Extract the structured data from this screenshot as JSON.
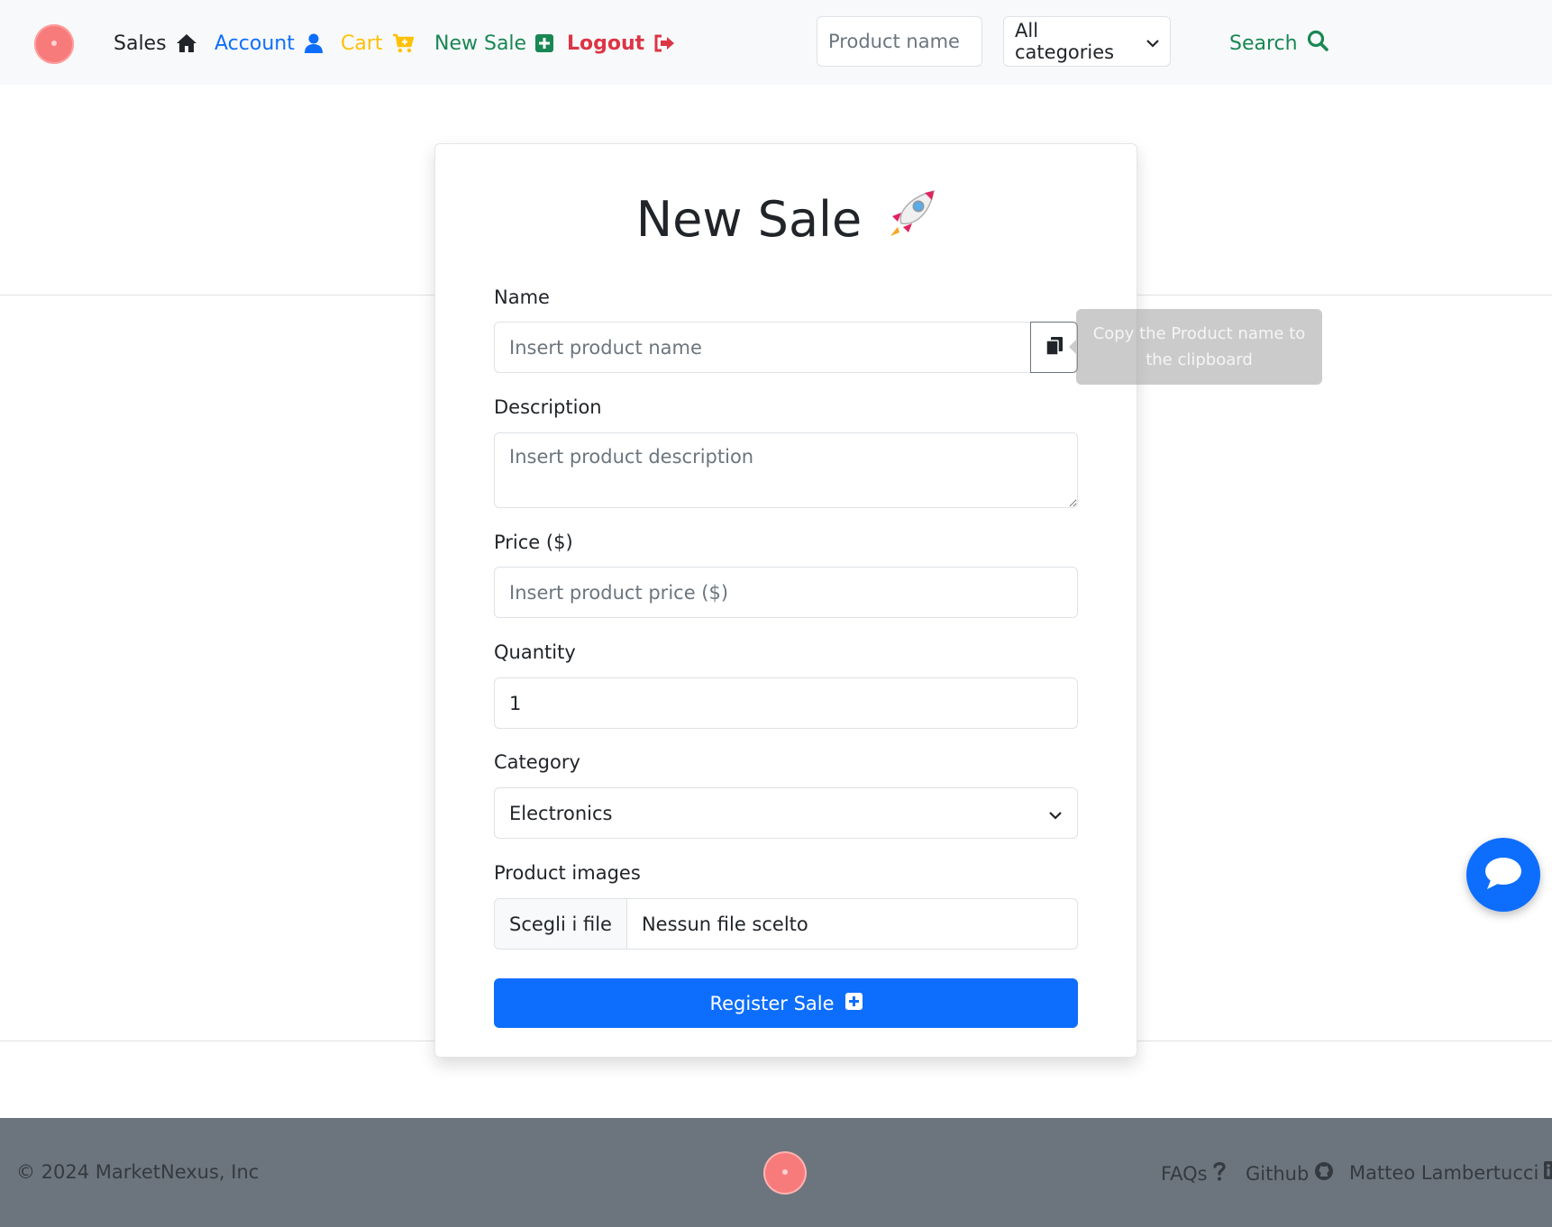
{
  "nav": {
    "sales_label": "Sales",
    "account_label": "Account",
    "cart_label": "Cart",
    "new_sale_label": "New Sale",
    "logout_label": "Logout",
    "search_placeholder": "Product name",
    "category_selected": "All categories",
    "search_label": "Search"
  },
  "form": {
    "title": "New Sale",
    "name_label": "Name",
    "name_placeholder": "Insert product name",
    "description_label": "Description",
    "description_placeholder": "Insert product description",
    "price_label": "Price ($)",
    "price_placeholder": "Insert product price ($)",
    "quantity_label": "Quantity",
    "quantity_value": "1",
    "category_label": "Category",
    "category_selected": "Electronics",
    "images_label": "Product images",
    "file_button_label": "Scegli i file",
    "file_status": "Nessun file scelto",
    "submit_label": "Register Sale"
  },
  "tooltip": {
    "text": "Copy the Product name to the clipboard"
  },
  "footer": {
    "copyright": "© 2024 MarketNexus, Inc",
    "faq_label": "FAQs",
    "github_label": "Github",
    "author_label": "Matteo Lambertucci"
  },
  "colors": {
    "primary": "#0d6efd",
    "success": "#198754",
    "warning": "#ffc107",
    "danger": "#dc3545",
    "footer_bg": "#6c757d",
    "logo": "#f87b7b"
  }
}
